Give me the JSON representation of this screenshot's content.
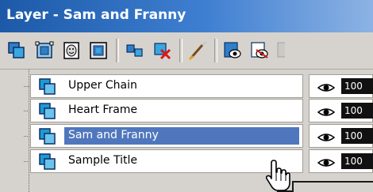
{
  "window": {
    "title": "Layer - Sam and Franny",
    "titlebar_color": "#2b6cc4"
  },
  "toolbar": {
    "buttons": [
      {
        "name": "new-raster-layer-icon"
      },
      {
        "name": "new-vector-layer-icon"
      },
      {
        "name": "new-mask-layer-icon"
      },
      {
        "name": "new-adjustment-layer-icon"
      },
      {
        "name": "duplicate-layer-icon"
      },
      {
        "name": "delete-layer-icon"
      },
      {
        "name": "edit-brush-icon"
      },
      {
        "name": "show-all-layers-icon"
      },
      {
        "name": "hide-all-layers-icon"
      }
    ]
  },
  "layers": [
    {
      "label": "Upper Chain",
      "opacity": "100",
      "selected": false
    },
    {
      "label": "Heart Frame",
      "opacity": "100",
      "selected": false
    },
    {
      "label": "Sam and Franny",
      "opacity": "100",
      "selected": true
    },
    {
      "label": "Sample Title",
      "opacity": "100",
      "selected": false
    }
  ],
  "colors": {
    "selection": "#5077bd",
    "layer_icon": "#1e9ad6"
  }
}
